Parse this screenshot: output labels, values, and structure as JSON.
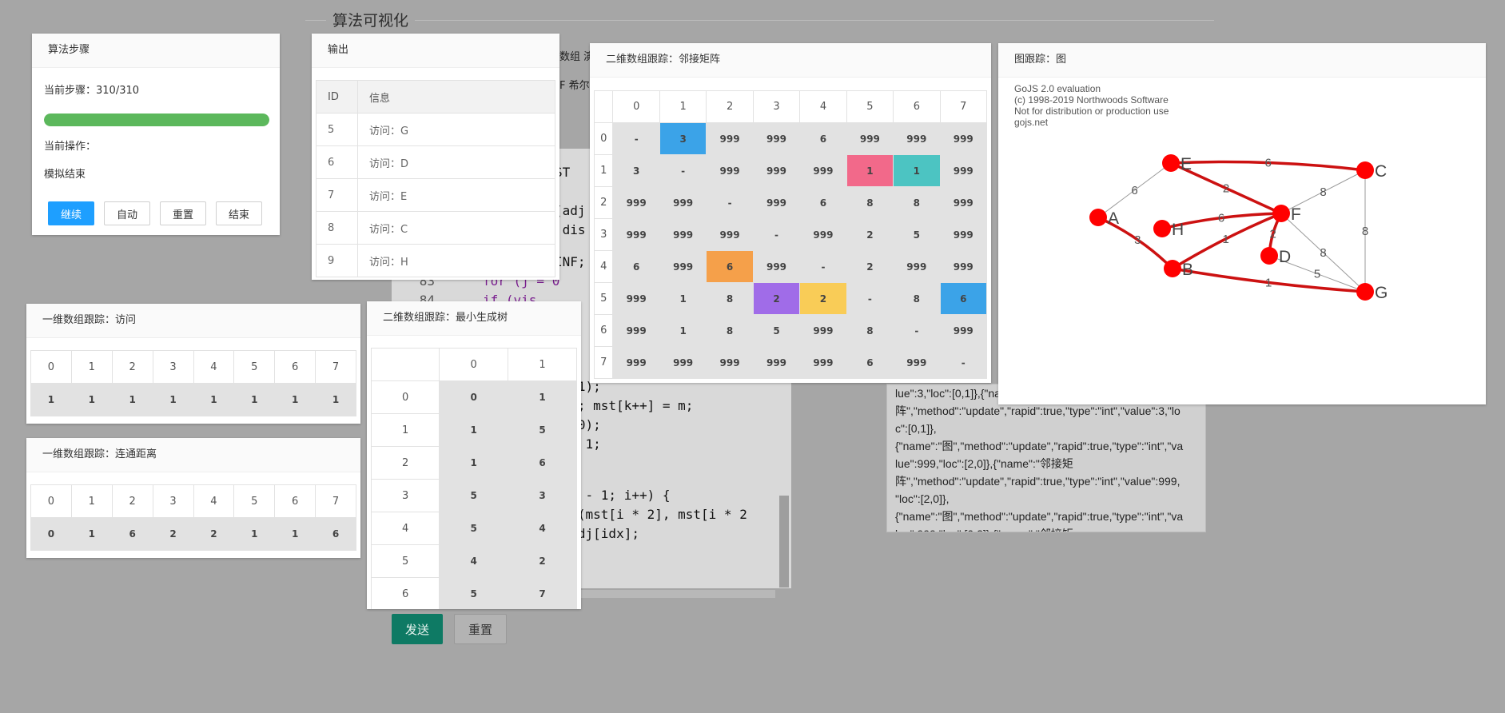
{
  "page": {
    "title": "算法可视化"
  },
  "background": {
    "code_lines": [
      {
        "ln": "",
        "text": "ST"
      },
      {
        "ln": "",
        "text": "(adj"
      },
      {
        "ln": "",
        "text": " dis"
      },
      {
        "ln": "",
        "text": "INF;"
      },
      {
        "ln": "83",
        "text": "for (j = 0"
      },
      {
        "ln": "84",
        "text": "if (vis"
      },
      {
        "ln": "",
        "text": "id(1);"
      },
      {
        "ln": "",
        "text": "= t; mst[k++] = m;"
      },
      {
        "ln": "",
        "text": "id(0);"
      },
      {
        "ln": "",
        "text": "] = 1;"
      },
      {
        "ln": "",
        "text": ");"
      },
      {
        "ln": "",
        "text": "< n - 1; i++) {"
      },
      {
        "ln": "",
        "text": " pt(mst[i * 2], mst[i * 2"
      },
      {
        "ln": "",
        "text": "= adj[idx];"
      },
      {
        "ln": "",
        "text": ");"
      }
    ],
    "under_text_1": "数组 演",
    "under_text_2": "F 希尔",
    "log_lines": [
      "lue\":3,\"loc\":[0,1]},{\"na",
      "阵\",\"method\":\"update\",\"rapid\":true,\"type\":\"int\",\"value\":3,\"lo",
      "c\":[0,1]},",
      "{\"name\":\"图\",\"method\":\"update\",\"rapid\":true,\"type\":\"int\",\"va",
      "lue\":999,\"loc\":[2,0]},{\"name\":\"邻接矩",
      "阵\",\"method\":\"update\",\"rapid\":true,\"type\":\"int\",\"value\":999,",
      "\"loc\":[2,0]},",
      "{\"name\":\"图\",\"method\":\"update\",\"rapid\":true,\"type\":\"int\",\"va",
      "lue\":999,\"loc\":[0,2]},{\"name\":\"邻接矩"
    ],
    "send_label": "发送",
    "reset_label": "重置"
  },
  "steps_panel": {
    "title": "算法步骤",
    "current_step_label": "当前步骤：310/310",
    "progress": 1.0,
    "progress_color": "#5cb85c",
    "current_op_label": "当前操作：",
    "op_text": "模拟结束",
    "buttons": [
      "继续",
      "自动",
      "重置",
      "结束"
    ]
  },
  "output_panel": {
    "title": "输出",
    "headers": [
      "ID",
      "信息"
    ],
    "rows": [
      [
        "5",
        "访问：G"
      ],
      [
        "6",
        "访问：D"
      ],
      [
        "7",
        "访问：E"
      ],
      [
        "8",
        "访问：C"
      ],
      [
        "9",
        "访问：H"
      ]
    ]
  },
  "visit_panel": {
    "title": "一维数组跟踪：访问",
    "indices": [
      "0",
      "1",
      "2",
      "3",
      "4",
      "5",
      "6",
      "7"
    ],
    "values": [
      "1",
      "1",
      "1",
      "1",
      "1",
      "1",
      "1",
      "1"
    ]
  },
  "dist_panel": {
    "title": "一维数组跟踪：连通距离",
    "indices": [
      "0",
      "1",
      "2",
      "3",
      "4",
      "5",
      "6",
      "7"
    ],
    "values": [
      "0",
      "1",
      "6",
      "2",
      "2",
      "1",
      "1",
      "6"
    ]
  },
  "mst_panel": {
    "title": "二维数组跟踪：最小生成树",
    "cols": [
      "0",
      "1"
    ],
    "rows": [
      {
        "idx": "0",
        "vals": [
          "0",
          "1"
        ]
      },
      {
        "idx": "1",
        "vals": [
          "1",
          "5"
        ]
      },
      {
        "idx": "2",
        "vals": [
          "1",
          "6"
        ]
      },
      {
        "idx": "3",
        "vals": [
          "5",
          "3"
        ]
      },
      {
        "idx": "4",
        "vals": [
          "5",
          "4"
        ]
      },
      {
        "idx": "5",
        "vals": [
          "4",
          "2"
        ]
      },
      {
        "idx": "6",
        "vals": [
          "5",
          "7"
        ]
      }
    ]
  },
  "matrix_panel": {
    "title": "二维数组跟踪：邻接矩阵",
    "cols": [
      "0",
      "1",
      "2",
      "3",
      "4",
      "5",
      "6",
      "7"
    ],
    "rows": [
      {
        "idx": "0",
        "vals": [
          "-",
          "3",
          "999",
          "999",
          "6",
          "999",
          "999",
          "999"
        ]
      },
      {
        "idx": "1",
        "vals": [
          "3",
          "-",
          "999",
          "999",
          "999",
          "1",
          "1",
          "999"
        ]
      },
      {
        "idx": "2",
        "vals": [
          "999",
          "999",
          "-",
          "999",
          "6",
          "8",
          "8",
          "999"
        ]
      },
      {
        "idx": "3",
        "vals": [
          "999",
          "999",
          "999",
          "-",
          "999",
          "2",
          "5",
          "999"
        ]
      },
      {
        "idx": "4",
        "vals": [
          "6",
          "999",
          "6",
          "999",
          "-",
          "2",
          "999",
          "999"
        ]
      },
      {
        "idx": "5",
        "vals": [
          "999",
          "1",
          "8",
          "2",
          "2",
          "-",
          "8",
          "6"
        ]
      },
      {
        "idx": "6",
        "vals": [
          "999",
          "1",
          "8",
          "5",
          "999",
          "8",
          "-",
          "999"
        ]
      },
      {
        "idx": "7",
        "vals": [
          "999",
          "999",
          "999",
          "999",
          "999",
          "6",
          "999",
          "-"
        ]
      }
    ],
    "highlights": [
      {
        "r": 0,
        "c": 1,
        "color": "#3ba3e8"
      },
      {
        "r": 1,
        "c": 5,
        "color": "#f2698a"
      },
      {
        "r": 1,
        "c": 6,
        "color": "#4cc4c2"
      },
      {
        "r": 4,
        "c": 2,
        "color": "#f5a04a"
      },
      {
        "r": 5,
        "c": 3,
        "color": "#a06ce8"
      },
      {
        "r": 5,
        "c": 4,
        "color": "#f9cc57"
      },
      {
        "r": 5,
        "c": 7,
        "color": "#3ba3e8"
      }
    ]
  },
  "graph_panel": {
    "title": "图跟踪：图",
    "watermark": [
      "GoJS 2.0 evaluation",
      "(c) 1998-2019 Northwoods Software",
      "Not for distribution or production use",
      "gojs.net"
    ],
    "node_color": "#ff0000",
    "edge_color_tree": "#cc1111",
    "edge_color_plain": "#999999",
    "nodes": [
      {
        "id": "A",
        "label": "A"
      },
      {
        "id": "B",
        "label": "B"
      },
      {
        "id": "C",
        "label": "C"
      },
      {
        "id": "D",
        "label": "D"
      },
      {
        "id": "E",
        "label": "E"
      },
      {
        "id": "F",
        "label": "F"
      },
      {
        "id": "G",
        "label": "G"
      },
      {
        "id": "H",
        "label": "H"
      }
    ],
    "edges": [
      {
        "from": "E",
        "to": "C",
        "w": "6",
        "tree": true
      },
      {
        "from": "E",
        "to": "A",
        "w": "6",
        "tree": false
      },
      {
        "from": "E",
        "to": "F",
        "w": "2",
        "tree": true
      },
      {
        "from": "C",
        "to": "F",
        "w": "8",
        "tree": false
      },
      {
        "from": "C",
        "to": "G",
        "w": "8",
        "tree": false
      },
      {
        "from": "H",
        "to": "F",
        "w": "6",
        "tree": true
      },
      {
        "from": "A",
        "to": "B",
        "w": "3",
        "tree": true
      },
      {
        "from": "B",
        "to": "F",
        "w": "1",
        "tree": true
      },
      {
        "from": "F",
        "to": "D",
        "w": "2",
        "tree": true
      },
      {
        "from": "F",
        "to": "G",
        "w": "8",
        "tree": false
      },
      {
        "from": "D",
        "to": "G",
        "w": "5",
        "tree": false
      },
      {
        "from": "B",
        "to": "G",
        "w": "1",
        "tree": true
      }
    ]
  }
}
